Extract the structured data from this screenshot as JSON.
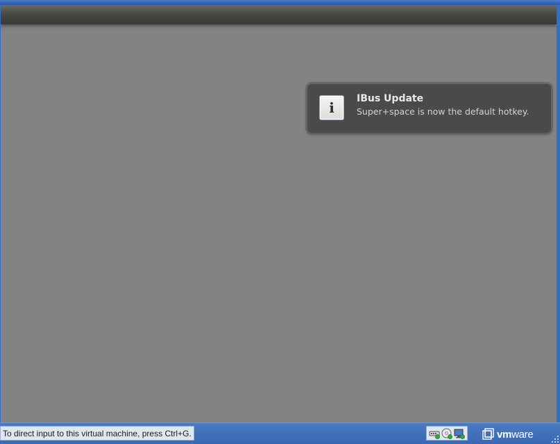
{
  "guest": {
    "notification": {
      "icon": "info-icon",
      "icon_glyph": "i",
      "title": "IBus Update",
      "body": "Super+space is now the default hotkey."
    }
  },
  "status_bar": {
    "message": "To direct input to this virtual machine, press Ctrl+G.",
    "devices": [
      {
        "name": "network-adapter-icon"
      },
      {
        "name": "cd-dvd-drive-icon"
      },
      {
        "name": "display-icon"
      }
    ],
    "brand": {
      "icon": "vmware-logo-icon",
      "text_prefix": "vm",
      "text_suffix": "ware"
    }
  },
  "colors": {
    "guest_background": "#848283",
    "window_frame": "#3c6db8",
    "notification_bg": "#4a4a48"
  }
}
